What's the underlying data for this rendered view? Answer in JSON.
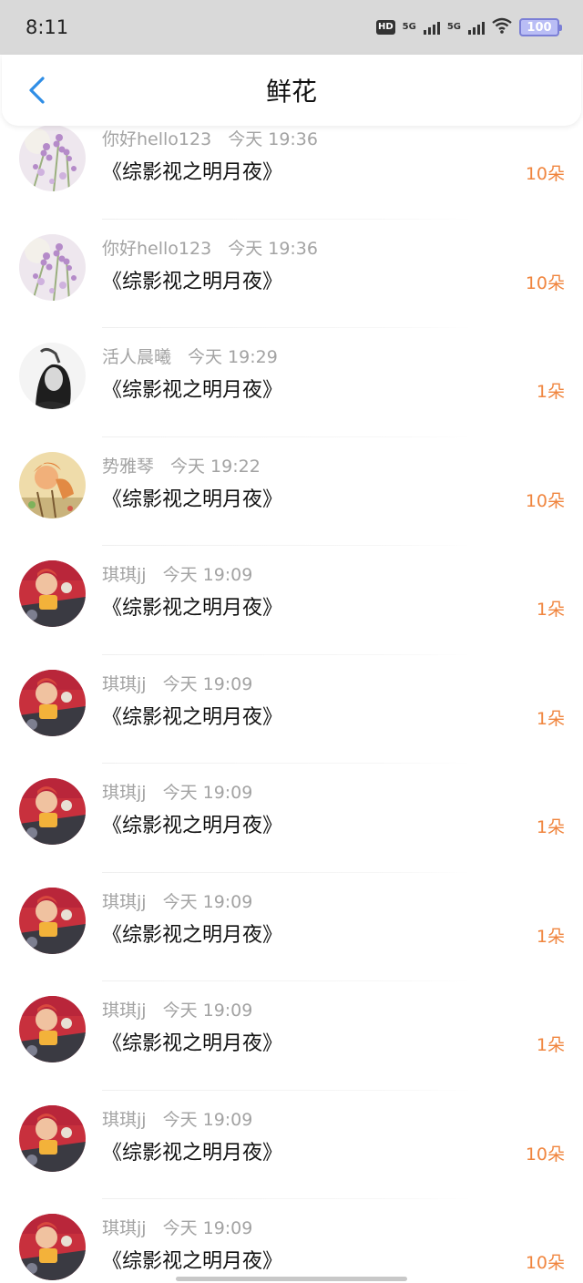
{
  "status_bar": {
    "time": "8:11",
    "battery": "100",
    "hd_label": "HD",
    "network_1": "5G",
    "network_2": "5G"
  },
  "header": {
    "title": "鲜花"
  },
  "colors": {
    "count_accent": "#f0853e",
    "back_arrow": "#2f8ee6",
    "meta_text": "#a3a3a3"
  },
  "icons": [
    "back-arrow-icon",
    "hd-icon",
    "signal-icon",
    "wifi-icon",
    "battery-icon"
  ],
  "gifts": [
    {
      "user": "你好hello123",
      "time": "今天 19:36",
      "book": "《综影视之明月夜》",
      "count": "10朵",
      "avatar": "lavender"
    },
    {
      "user": "你好hello123",
      "time": "今天 19:36",
      "book": "《综影视之明月夜》",
      "count": "10朵",
      "avatar": "lavender"
    },
    {
      "user": "活人晨曦",
      "time": "今天 19:29",
      "book": "《综影视之明月夜》",
      "count": "1朵",
      "avatar": "portrait-bw"
    },
    {
      "user": "势雅琴",
      "time": "今天 19:22",
      "book": "《综影视之明月夜》",
      "count": "10朵",
      "avatar": "illustration"
    },
    {
      "user": "琪琪jj",
      "time": "今天 19:09",
      "book": "《综影视之明月夜》",
      "count": "1朵",
      "avatar": "child-red"
    },
    {
      "user": "琪琪jj",
      "time": "今天 19:09",
      "book": "《综影视之明月夜》",
      "count": "1朵",
      "avatar": "child-red"
    },
    {
      "user": "琪琪jj",
      "time": "今天 19:09",
      "book": "《综影视之明月夜》",
      "count": "1朵",
      "avatar": "child-red"
    },
    {
      "user": "琪琪jj",
      "time": "今天 19:09",
      "book": "《综影视之明月夜》",
      "count": "1朵",
      "avatar": "child-red"
    },
    {
      "user": "琪琪jj",
      "time": "今天 19:09",
      "book": "《综影视之明月夜》",
      "count": "1朵",
      "avatar": "child-red"
    },
    {
      "user": "琪琪jj",
      "time": "今天 19:09",
      "book": "《综影视之明月夜》",
      "count": "10朵",
      "avatar": "child-red"
    },
    {
      "user": "琪琪jj",
      "time": "今天 19:09",
      "book": "《综影视之明月夜》",
      "count": "10朵",
      "avatar": "child-red"
    }
  ]
}
